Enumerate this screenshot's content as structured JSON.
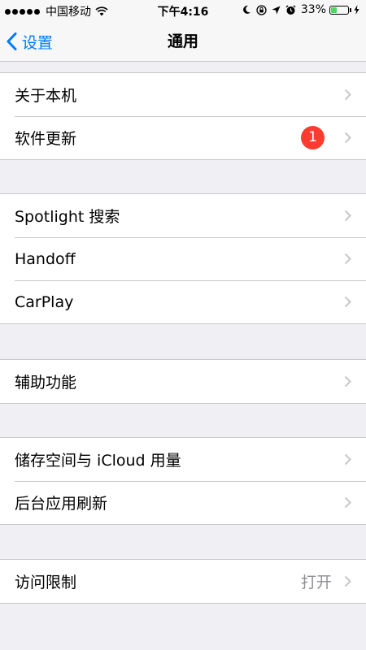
{
  "status_bar": {
    "carrier": "中国移动",
    "time": "下午4:16",
    "battery_percent": "33%",
    "battery_level": 0.33,
    "battery_color": "#4cd964",
    "icons": [
      "signal-dots-icon",
      "wifi-icon",
      "moon-icon",
      "orientation-lock-icon",
      "location-arrow-icon",
      "alarm-icon",
      "battery-icon",
      "charging-bolt-icon"
    ]
  },
  "nav": {
    "back_label": "设置",
    "title": "通用",
    "accent_color": "#007aff"
  },
  "groups": [
    {
      "rows": [
        {
          "label": "关于本机"
        },
        {
          "label": "软件更新",
          "badge": "1"
        }
      ]
    },
    {
      "rows": [
        {
          "label": "Spotlight 搜索"
        },
        {
          "label": "Handoff"
        },
        {
          "label": "CarPlay"
        }
      ]
    },
    {
      "rows": [
        {
          "label": "辅助功能"
        }
      ]
    },
    {
      "rows": [
        {
          "label": "储存空间与 iCloud 用量"
        },
        {
          "label": "后台应用刷新"
        }
      ]
    },
    {
      "rows": [
        {
          "label": "访问限制",
          "value": "打开"
        }
      ]
    }
  ]
}
